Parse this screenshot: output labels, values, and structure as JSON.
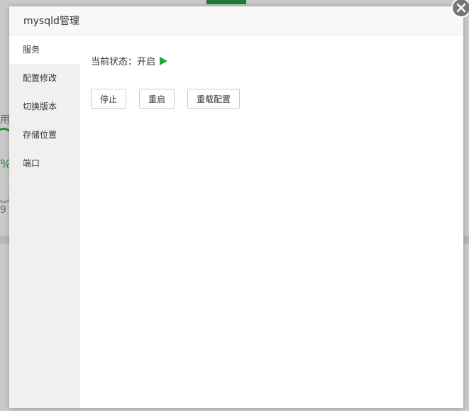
{
  "background": {
    "fragment_use": "用",
    "fragment_percent": "%",
    "fragment_nine": "9 ("
  },
  "modal": {
    "title": "mysqld管理",
    "sidebar": {
      "items": [
        {
          "label": "服务",
          "active": true
        },
        {
          "label": "配置修改",
          "active": false
        },
        {
          "label": "切换版本",
          "active": false
        },
        {
          "label": "存储位置",
          "active": false
        },
        {
          "label": "端口",
          "active": false
        }
      ]
    },
    "content": {
      "status_label": "当前状态：开启",
      "status_icon": "play-icon",
      "status_color": "#20a53a",
      "buttons": {
        "stop": "停止",
        "restart": "重启",
        "reload": "重载配置"
      }
    },
    "close_icon": "close-icon"
  }
}
